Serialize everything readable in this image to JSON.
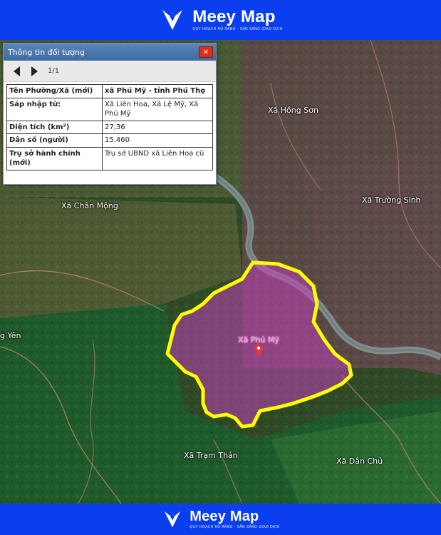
{
  "brand": {
    "name": "Meey Map",
    "tagline": "QUY HOẠCH RÕ RÀNG - SẴN SÀNG GIAO DỊCH"
  },
  "panel": {
    "title": "Thông tin đối tượng",
    "close_label": "×",
    "pager": "1/1",
    "rows": [
      {
        "key": "Tên Phường/Xã (mới)",
        "value": "xã Phú Mỹ - tỉnh Phú Thọ"
      },
      {
        "key": "Sáp nhập từ:",
        "value": "Xã Liên Hoa, Xã Lệ Mỹ, Xã Phú Mỹ"
      },
      {
        "key": "Diện tích (km²)",
        "value": "27,36"
      },
      {
        "key": "Dân số (người)",
        "value": "15.460"
      },
      {
        "key": "Trụ sở hành chính (mới)",
        "value": "Trụ sở UBND xã Liên Hoa cũ"
      }
    ]
  },
  "map": {
    "highlight_label": "Xã Phú Mỹ",
    "places": [
      "Xã Hồng Sơn",
      "Xã Trường Sinh",
      "Xã Chân Mộng",
      "g Yên",
      "Xã Trạm Thản",
      "Xã Dân Chủ"
    ],
    "colors": {
      "boundary": "#ffff00",
      "fill": "#c040b8",
      "label": "#ff6bd6",
      "river": "#8a9a9a",
      "road": "#c98a7a"
    }
  }
}
